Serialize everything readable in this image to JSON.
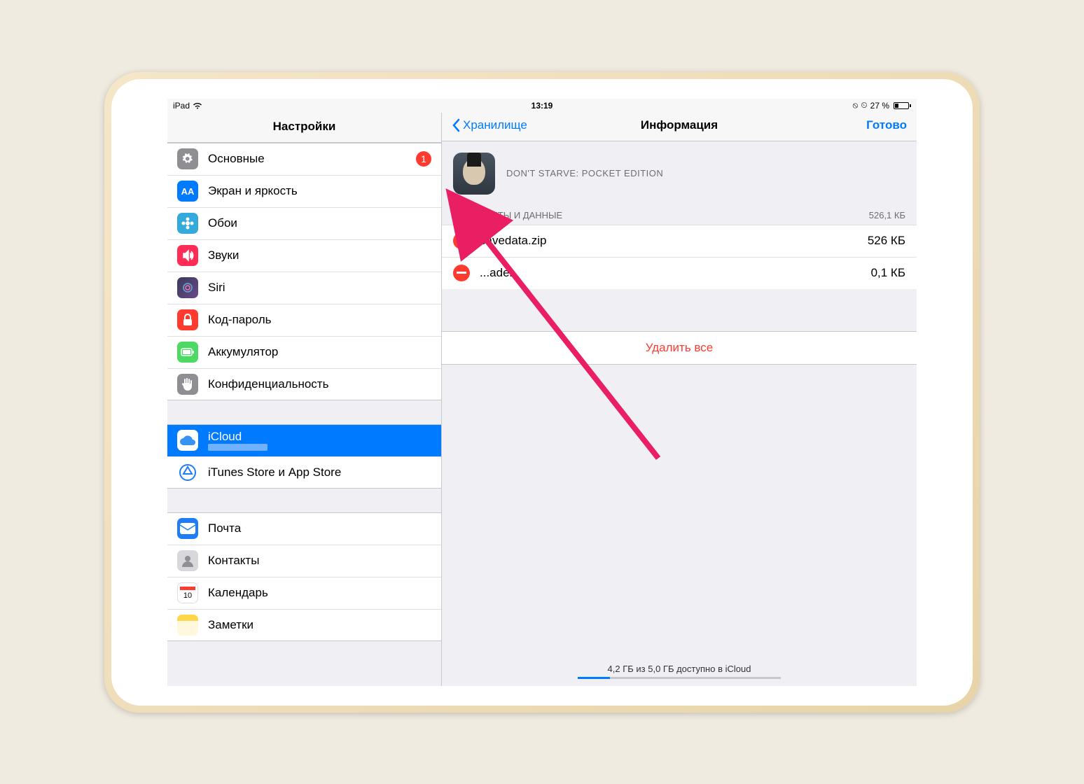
{
  "status": {
    "device": "iPad",
    "time": "13:19",
    "battery_pct": "27 %",
    "lock": "⊗",
    "alarm": "⏰"
  },
  "sidebar": {
    "title": "Настройки",
    "items": [
      {
        "label": "Основные",
        "badge": "1"
      },
      {
        "label": "Экран и яркость"
      },
      {
        "label": "Обои"
      },
      {
        "label": "Звуки"
      },
      {
        "label": "Siri"
      },
      {
        "label": "Код-пароль"
      },
      {
        "label": "Аккумулятор"
      },
      {
        "label": "Конфиденциальность"
      }
    ],
    "group2": [
      {
        "label": "iCloud"
      },
      {
        "label": "iTunes Store и App Store"
      }
    ],
    "group3": [
      {
        "label": "Почта"
      },
      {
        "label": "Контакты"
      },
      {
        "label": "Календарь"
      },
      {
        "label": "Заметки"
      }
    ]
  },
  "detail": {
    "back": "Хранилище",
    "title": "Информация",
    "done": "Готово",
    "app_name": "DON'T STARVE: POCKET EDITION",
    "section": "ДОКУМЕНТЫ И ДАННЫЕ",
    "section_size": "526,1 КБ",
    "files": [
      {
        "name": "savedata.zip",
        "size": "526 КБ"
      },
      {
        "name": "...ader",
        "size": "0,1 КБ"
      }
    ],
    "delete_all": "Удалить все",
    "storage_text": "4,2 ГБ из 5,0 ГБ доступно в iCloud"
  }
}
